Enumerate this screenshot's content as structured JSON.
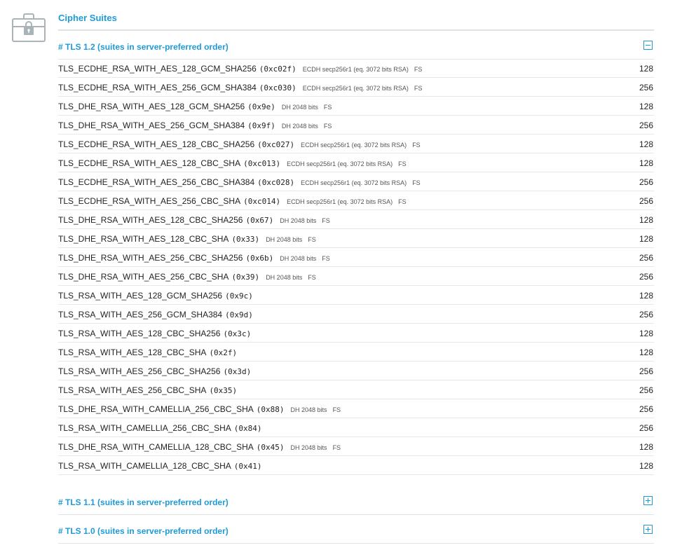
{
  "title": "Cipher Suites",
  "sections": [
    {
      "label": "# TLS 1.2 (suites in server-preferred order)",
      "toggle": "collapse-icon"
    },
    {
      "label": "# TLS 1.1 (suites in server-preferred order)",
      "toggle": "expand-icon"
    },
    {
      "label": "# TLS 1.0 (suites in server-preferred order)",
      "toggle": "expand-icon"
    }
  ],
  "suites": [
    {
      "name": "TLS_ECDHE_RSA_WITH_AES_128_GCM_SHA256",
      "code": "(0xc02f)",
      "kx": "ECDH secp256r1 (eq. 3072 bits RSA)",
      "fs": "FS",
      "bits": "128"
    },
    {
      "name": "TLS_ECDHE_RSA_WITH_AES_256_GCM_SHA384",
      "code": "(0xc030)",
      "kx": "ECDH secp256r1 (eq. 3072 bits RSA)",
      "fs": "FS",
      "bits": "256"
    },
    {
      "name": "TLS_DHE_RSA_WITH_AES_128_GCM_SHA256",
      "code": "(0x9e)",
      "kx": "DH 2048 bits",
      "fs": "FS",
      "bits": "128"
    },
    {
      "name": "TLS_DHE_RSA_WITH_AES_256_GCM_SHA384",
      "code": "(0x9f)",
      "kx": "DH 2048 bits",
      "fs": "FS",
      "bits": "256"
    },
    {
      "name": "TLS_ECDHE_RSA_WITH_AES_128_CBC_SHA256",
      "code": "(0xc027)",
      "kx": "ECDH secp256r1 (eq. 3072 bits RSA)",
      "fs": "FS",
      "bits": "128"
    },
    {
      "name": "TLS_ECDHE_RSA_WITH_AES_128_CBC_SHA",
      "code": "(0xc013)",
      "kx": "ECDH secp256r1 (eq. 3072 bits RSA)",
      "fs": "FS",
      "bits": "128"
    },
    {
      "name": "TLS_ECDHE_RSA_WITH_AES_256_CBC_SHA384",
      "code": "(0xc028)",
      "kx": "ECDH secp256r1 (eq. 3072 bits RSA)",
      "fs": "FS",
      "bits": "256"
    },
    {
      "name": "TLS_ECDHE_RSA_WITH_AES_256_CBC_SHA",
      "code": "(0xc014)",
      "kx": "ECDH secp256r1 (eq. 3072 bits RSA)",
      "fs": "FS",
      "bits": "256"
    },
    {
      "name": "TLS_DHE_RSA_WITH_AES_128_CBC_SHA256",
      "code": "(0x67)",
      "kx": "DH 2048 bits",
      "fs": "FS",
      "bits": "128"
    },
    {
      "name": "TLS_DHE_RSA_WITH_AES_128_CBC_SHA",
      "code": "(0x33)",
      "kx": "DH 2048 bits",
      "fs": "FS",
      "bits": "128"
    },
    {
      "name": "TLS_DHE_RSA_WITH_AES_256_CBC_SHA256",
      "code": "(0x6b)",
      "kx": "DH 2048 bits",
      "fs": "FS",
      "bits": "256"
    },
    {
      "name": "TLS_DHE_RSA_WITH_AES_256_CBC_SHA",
      "code": "(0x39)",
      "kx": "DH 2048 bits",
      "fs": "FS",
      "bits": "256"
    },
    {
      "name": "TLS_RSA_WITH_AES_128_GCM_SHA256",
      "code": "(0x9c)",
      "kx": "",
      "fs": "",
      "bits": "128"
    },
    {
      "name": "TLS_RSA_WITH_AES_256_GCM_SHA384",
      "code": "(0x9d)",
      "kx": "",
      "fs": "",
      "bits": "256"
    },
    {
      "name": "TLS_RSA_WITH_AES_128_CBC_SHA256",
      "code": "(0x3c)",
      "kx": "",
      "fs": "",
      "bits": "128"
    },
    {
      "name": "TLS_RSA_WITH_AES_128_CBC_SHA",
      "code": "(0x2f)",
      "kx": "",
      "fs": "",
      "bits": "128"
    },
    {
      "name": "TLS_RSA_WITH_AES_256_CBC_SHA256",
      "code": "(0x3d)",
      "kx": "",
      "fs": "",
      "bits": "256"
    },
    {
      "name": "TLS_RSA_WITH_AES_256_CBC_SHA",
      "code": "(0x35)",
      "kx": "",
      "fs": "",
      "bits": "256"
    },
    {
      "name": "TLS_DHE_RSA_WITH_CAMELLIA_256_CBC_SHA",
      "code": "(0x88)",
      "kx": "DH 2048 bits",
      "fs": "FS",
      "bits": "256"
    },
    {
      "name": "TLS_RSA_WITH_CAMELLIA_256_CBC_SHA",
      "code": "(0x84)",
      "kx": "",
      "fs": "",
      "bits": "256"
    },
    {
      "name": "TLS_DHE_RSA_WITH_CAMELLIA_128_CBC_SHA",
      "code": "(0x45)",
      "kx": "DH 2048 bits",
      "fs": "FS",
      "bits": "128"
    },
    {
      "name": "TLS_RSA_WITH_CAMELLIA_128_CBC_SHA",
      "code": "(0x41)",
      "kx": "",
      "fs": "",
      "bits": "128"
    }
  ],
  "colors": {
    "accent": "#1e9bd7",
    "icon": "#a9b4b8",
    "rule": "#dde3e5"
  }
}
